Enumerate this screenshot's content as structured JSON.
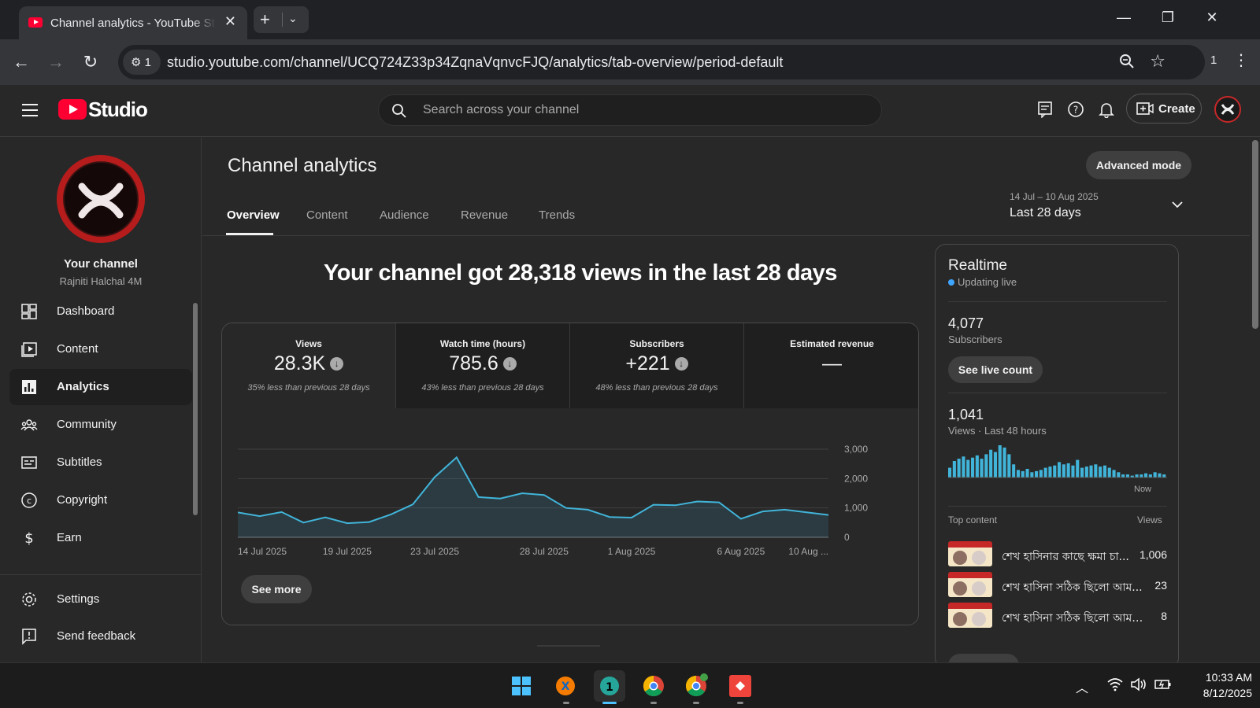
{
  "browser": {
    "tab_title": "Channel analytics - YouTube Studio",
    "url": "studio.youtube.com/channel/UCQ724Z33p34ZqnaVqnvcFJQ/analytics/tab-overview/period-default",
    "site_info_count": "1",
    "profile_count": "1"
  },
  "header": {
    "logo_text": "Studio",
    "search_placeholder": "Search across your channel",
    "create_label": "Create"
  },
  "sidebar": {
    "your_channel": "Your channel",
    "channel_name": "Rajniti Halchal 4M",
    "items": [
      {
        "label": "Dashboard",
        "icon": "dashboard-icon"
      },
      {
        "label": "Content",
        "icon": "content-icon"
      },
      {
        "label": "Analytics",
        "icon": "analytics-icon",
        "active": true
      },
      {
        "label": "Community",
        "icon": "community-icon"
      },
      {
        "label": "Subtitles",
        "icon": "subtitles-icon"
      },
      {
        "label": "Copyright",
        "icon": "copyright-icon"
      },
      {
        "label": "Earn",
        "icon": "dollar-icon"
      }
    ],
    "bottom_items": [
      {
        "label": "Settings",
        "icon": "gear-icon"
      },
      {
        "label": "Send feedback",
        "icon": "feedback-icon"
      }
    ]
  },
  "main": {
    "title": "Channel analytics",
    "advanced_mode": "Advanced mode",
    "tabs": [
      "Overview",
      "Content",
      "Audience",
      "Revenue",
      "Trends"
    ],
    "active_tab": "Overview",
    "date_range": "14 Jul – 10 Aug 2025",
    "date_label": "Last 28 days",
    "headline": "Your channel got 28,318 views in the last 28 days",
    "metrics": [
      {
        "title": "Views",
        "value": "28.3K",
        "compare": "35% less than previous 28 days",
        "trend": "down"
      },
      {
        "title": "Watch time (hours)",
        "value": "785.6",
        "compare": "43% less than previous 28 days",
        "trend": "down"
      },
      {
        "title": "Subscribers",
        "value": "+221",
        "compare": "48% less than previous 28 days",
        "trend": "down"
      },
      {
        "title": "Estimated revenue",
        "value": "—",
        "compare": "",
        "trend": ""
      }
    ],
    "see_more": "See more"
  },
  "chart_data": {
    "type": "area",
    "x_tick_labels": [
      "14 Jul 2025",
      "19 Jul 2025",
      "23 Jul 2025",
      "28 Jul 2025",
      "1 Aug 2025",
      "6 Aug 2025",
      "10 Aug ..."
    ],
    "y_tick_labels": [
      "3,000",
      "2,000",
      "1,000",
      "0"
    ],
    "ylim": [
      0,
      3000
    ],
    "yticks": [
      0,
      1000,
      2000,
      3000
    ],
    "series": [
      {
        "values": [
          850,
          720,
          860,
          500,
          680,
          480,
          520,
          780,
          1120,
          2050,
          2720,
          1370,
          1320,
          1500,
          1440,
          1000,
          940,
          690,
          670,
          1110,
          1090,
          1220,
          1190,
          630,
          880,
          940,
          850,
          760
        ]
      }
    ],
    "color": "#41b4d9",
    "grid": true
  },
  "realtime": {
    "title": "Realtime",
    "live_label": "Updating live",
    "subscribers_value": "4,077",
    "subscribers_label": "Subscribers",
    "live_count_btn": "See live count",
    "views_value": "1,041",
    "views_label": "Views · Last 48 hours",
    "now_label": "Now",
    "bar_values": [
      8,
      14,
      16,
      18,
      15,
      17,
      19,
      16,
      20,
      24,
      22,
      28,
      26,
      20,
      11,
      6,
      5,
      7,
      4,
      5,
      6,
      8,
      9,
      10,
      13,
      11,
      12,
      10,
      15,
      8,
      9,
      10,
      11,
      9,
      10,
      8,
      6,
      4,
      2,
      2,
      1,
      2,
      2,
      3,
      2,
      4,
      3,
      2
    ],
    "top_content_label": "Top content",
    "top_content_views_label": "Views",
    "top_content": [
      {
        "title": "শেখ হাসিনার কাছে ক্ষমা চা...",
        "views": "1,006"
      },
      {
        "title": "শেখ হাসিনা সঠিক ছিলো আম...",
        "views": "23"
      },
      {
        "title": "শেখ হাসিনা সঠিক ছিলো আমরা...",
        "views": "8"
      }
    ]
  },
  "taskbar": {
    "time": "10:33 AM",
    "date": "8/12/2025",
    "apps": [
      "windows-start-icon",
      "firefox-like-icon",
      "tab-counter-app-icon",
      "chrome-icon",
      "chrome-profile-icon",
      "anydesk-icon"
    ]
  },
  "colors": {
    "accent": "#3ea6ff",
    "youtube_red": "#ff0033",
    "chart_line": "#41b4d9"
  }
}
